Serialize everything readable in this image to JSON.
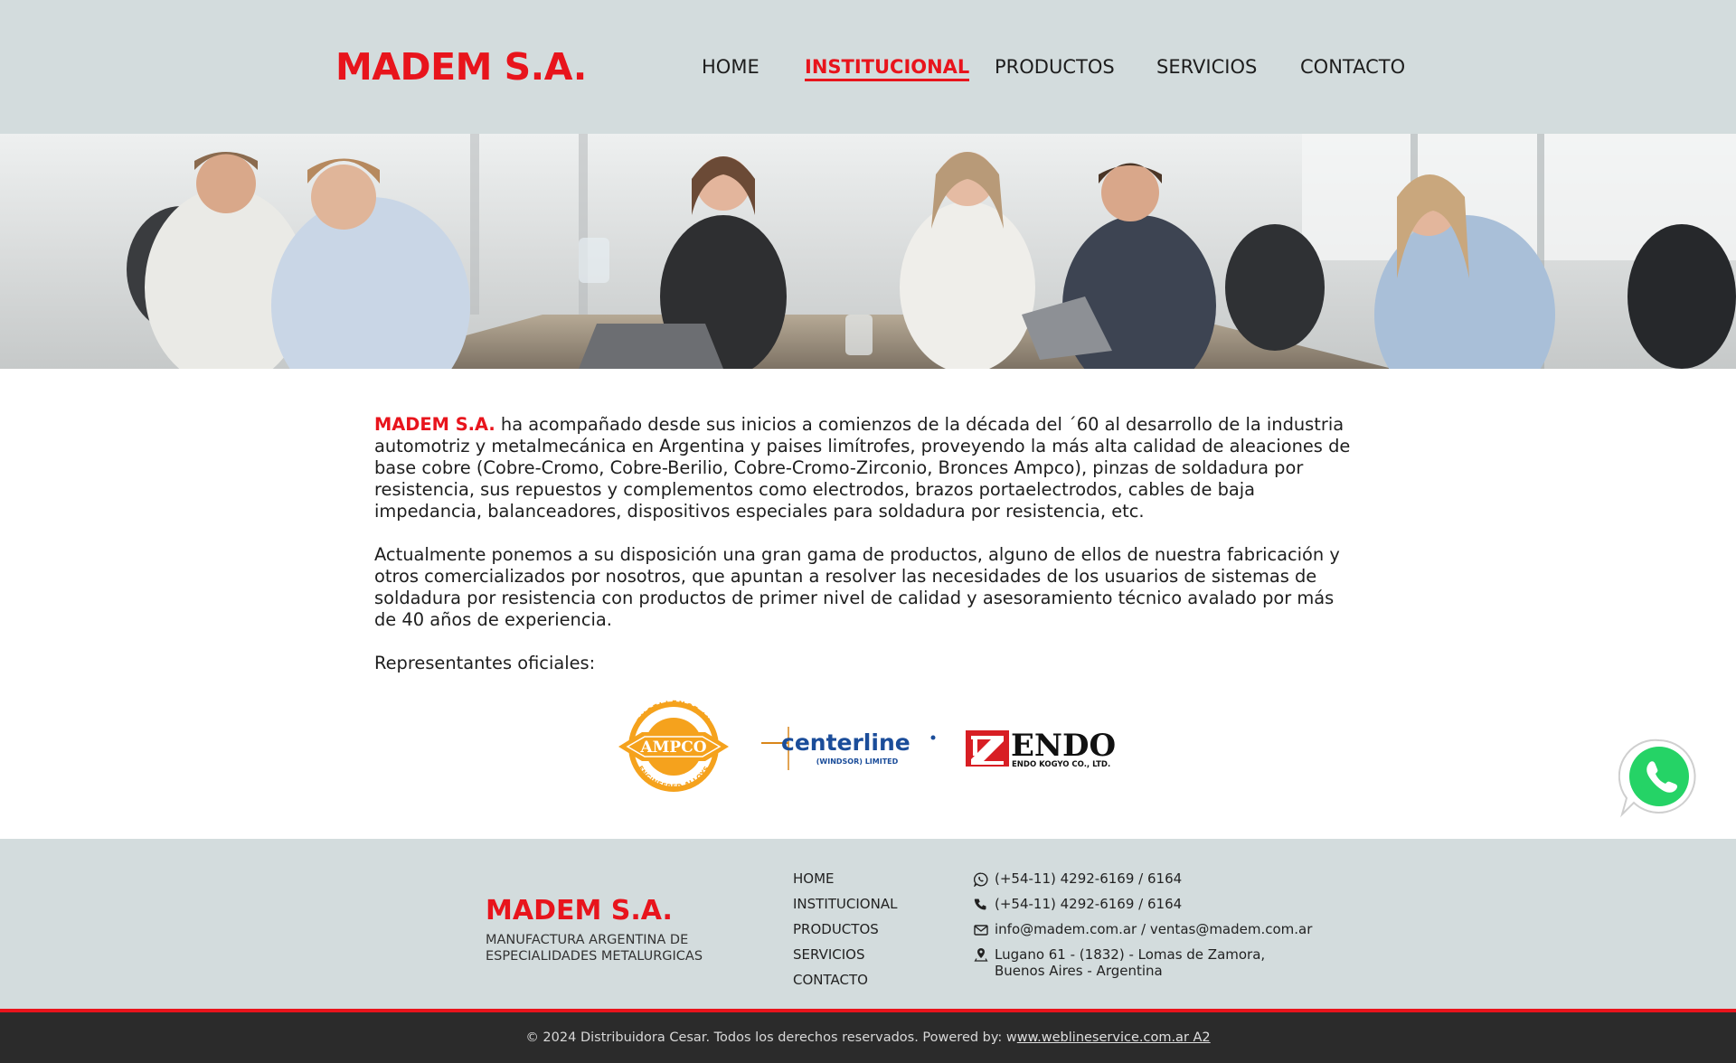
{
  "header": {
    "logo": "MADEM S.A.",
    "nav": [
      {
        "label": "HOME"
      },
      {
        "label": "INSTITUCIONAL",
        "active": true
      },
      {
        "label": "PRODUCTOS"
      },
      {
        "label": "SERVICIOS"
      },
      {
        "label": "CONTACTO"
      }
    ]
  },
  "hero": {
    "image": "office-meeting-photo"
  },
  "content": {
    "p1_brand": "MADEM S.A.",
    "p1_text": " ha acompañado desde sus inicios a comienzos de la década del ´60 al desarrollo de la industria automotriz y metalmecánica en Argentina y paises limítrofes, proveyendo la más alta calidad de aleaciones de base cobre (Cobre-Cromo, Cobre-Berilio, Cobre-Cromo-Zirconio, Bronces Ampco), pinzas de soldadura por resistencia, sus repuestos y complementos como electrodos, brazos portaelectrodos, cables de baja impedancia, balanceadores, dispositivos especiales para soldadura por resistencia, etc.",
    "p2": "Actualmente ponemos a su disposición una gran gama de productos, alguno de ellos de nuestra fabricación y otros comercializados por nosotros, que apuntan a resolver las necesidades de los usuarios de sistemas de soldadura por resistencia con productos de primer nivel de calidad y asesoramiento técnico avalado por más de 40 años de experiencia.",
    "reps_title": "Representantes oficiales:"
  },
  "representatives": {
    "ampco": {
      "ring_top": "EXCELLENCE IN",
      "center": "AMPCO",
      "ring_bottom": "ENGINEERED ALLOYS"
    },
    "centerline": {
      "name": "centerline",
      "sub": "(WINDSOR) LIMITED"
    },
    "endo": {
      "name": "ENDO",
      "sub": "ENDO KOGYO CO., LTD."
    }
  },
  "footer": {
    "logo": "MADEM S.A.",
    "tagline": "MANUFACTURA ARGENTINA DE ESPECIALIDADES METALURGICAS",
    "nav": [
      "HOME",
      "INSTITUCIONAL",
      "PRODUCTOS",
      "SERVICIOS",
      "CONTACTO"
    ],
    "whatsapp": "(+54-11) 4292-6169 / 6164",
    "phone": "(+54-11) 4292-6169 / 6164",
    "email": "info@madem.com.ar / ventas@madem.com.ar",
    "address_line1": "Lugano 61 - (1832) - Lomas de Zamora,",
    "address_line2": "Buenos Aires - Argentina"
  },
  "copyright": {
    "text": "© 2024 Distribuidora Cesar. Todos los derechos reservados. Powered by: w",
    "link": "ww.weblineservice.com.ar A2"
  },
  "colors": {
    "accent": "#e8141c",
    "header_bg": "#d3dcdd",
    "footer_bottom": "#2b2b2b"
  },
  "icons": [
    "whatsapp-icon",
    "phone-icon",
    "mail-icon",
    "location-icon"
  ]
}
